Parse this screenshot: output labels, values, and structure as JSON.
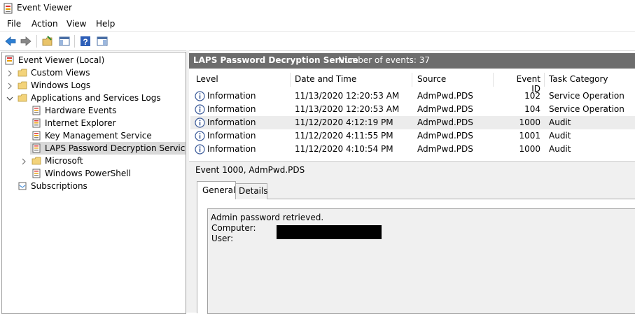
{
  "window": {
    "title": "Event Viewer"
  },
  "menu": [
    "File",
    "Action",
    "View",
    "Help"
  ],
  "toolbar": [
    "back-icon",
    "forward-icon",
    "open-folder-icon",
    "show-hide-tree-icon",
    "help-icon",
    "show-hide-action-pane-icon"
  ],
  "tree": {
    "root": "Event Viewer (Local)",
    "custom_views": "Custom Views",
    "windows_logs": "Windows Logs",
    "apps_services": "Applications and Services Logs",
    "hardware_events": "Hardware Events",
    "internet_explorer": "Internet Explorer",
    "key_management": "Key Management Service",
    "laps": "LAPS Password Decryption Service",
    "microsoft": "Microsoft",
    "powershell": "Windows PowerShell",
    "subscriptions": "Subscriptions"
  },
  "log_header": {
    "name": "LAPS Password Decryption Service",
    "count": "Number of events: 37"
  },
  "grid": {
    "columns": [
      "Level",
      "Date and Time",
      "Source",
      "Event ID",
      "Task Category"
    ],
    "rows": [
      {
        "level": "Information",
        "date": "11/13/2020 12:20:53 AM",
        "source": "AdmPwd.PDS",
        "event_id": "102",
        "category": "Service Operation"
      },
      {
        "level": "Information",
        "date": "11/13/2020 12:20:53 AM",
        "source": "AdmPwd.PDS",
        "event_id": "104",
        "category": "Service Operation"
      },
      {
        "level": "Information",
        "date": "11/12/2020 4:12:19 PM",
        "source": "AdmPwd.PDS",
        "event_id": "1000",
        "category": "Audit"
      },
      {
        "level": "Information",
        "date": "11/12/2020 4:11:55 PM",
        "source": "AdmPwd.PDS",
        "event_id": "1001",
        "category": "Audit"
      },
      {
        "level": "Information",
        "date": "11/12/2020 4:10:54 PM",
        "source": "AdmPwd.PDS",
        "event_id": "1000",
        "category": "Audit"
      }
    ]
  },
  "detail": {
    "title": "Event 1000, AdmPwd.PDS",
    "tabs": [
      "General",
      "Details"
    ],
    "message": "Admin password retrieved.",
    "computer_label": "Computer:",
    "user_label": "User:"
  }
}
